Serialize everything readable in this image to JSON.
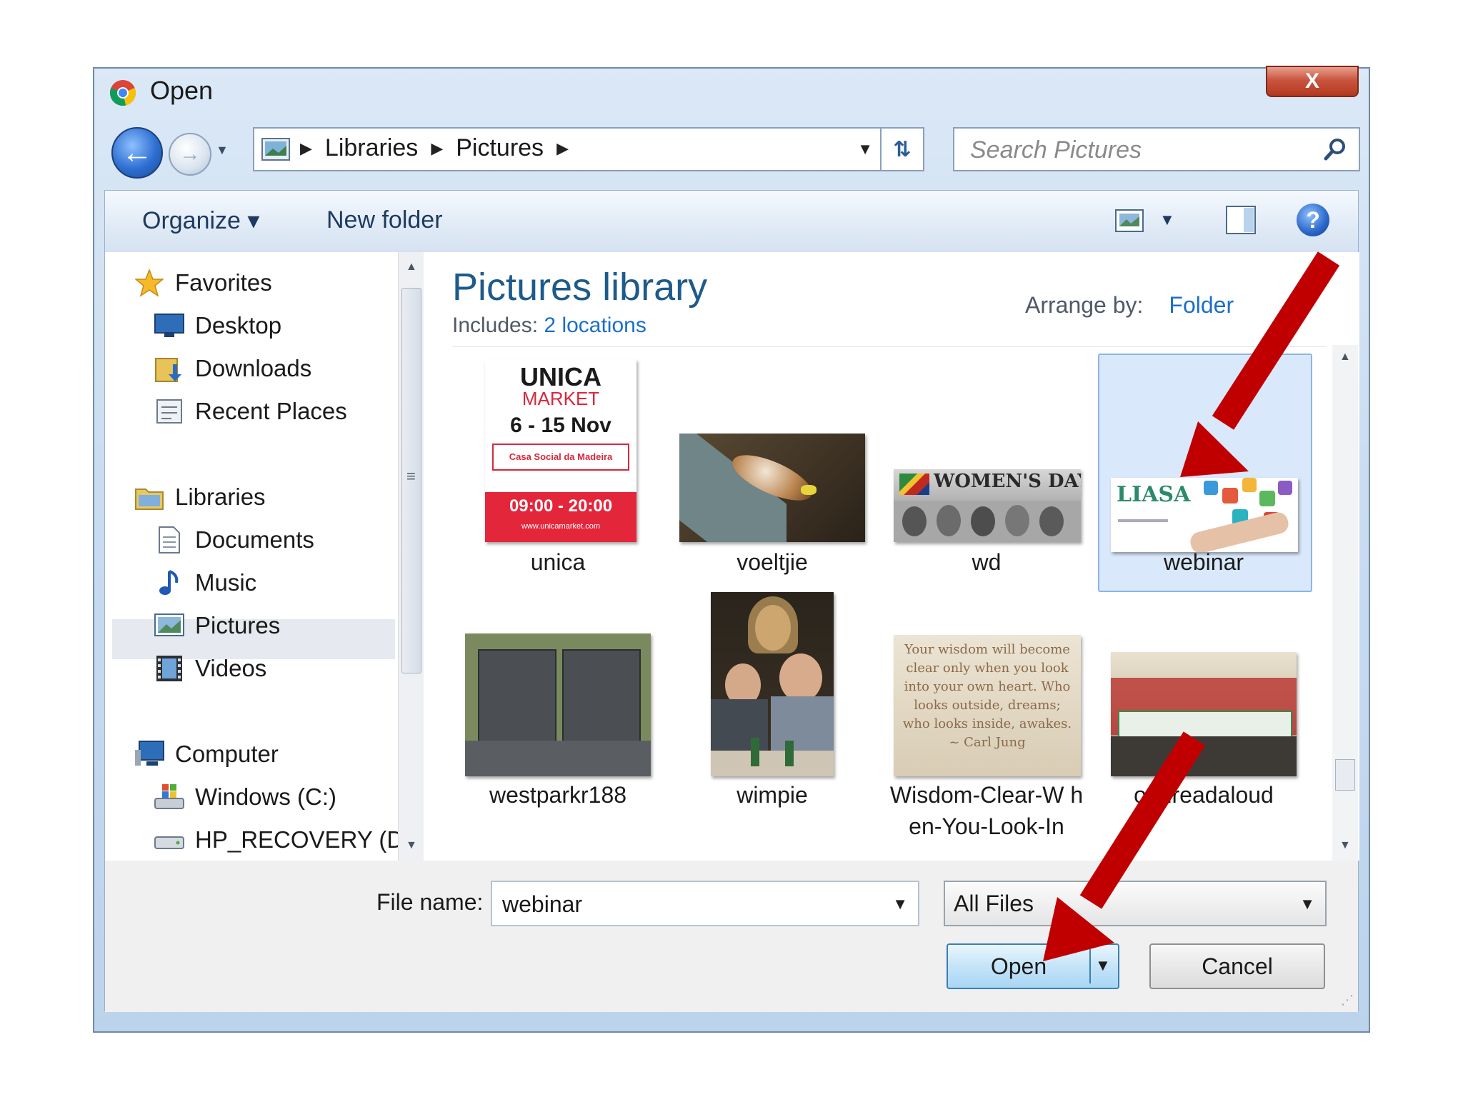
{
  "window": {
    "title": "Open",
    "close_label": "X"
  },
  "address": {
    "crumbs": [
      "Libraries",
      "Pictures"
    ],
    "search_placeholder": "Search Pictures"
  },
  "toolbar": {
    "organize": "Organize ▾",
    "new_folder": "New folder",
    "help": "?"
  },
  "nav": {
    "favorites": "Favorites",
    "desktop": "Desktop",
    "downloads": "Downloads",
    "recent": "Recent Places",
    "libraries": "Libraries",
    "documents": "Documents",
    "music": "Music",
    "pictures": "Pictures",
    "videos": "Videos",
    "computer": "Computer",
    "windows": "Windows (C:)",
    "recovery": "HP_RECOVERY (D"
  },
  "library": {
    "title": "Pictures library",
    "includes_label": "Includes:",
    "includes_link": "2 locations",
    "arrange_label": "Arrange by:",
    "arrange_value": "Folder"
  },
  "files": [
    {
      "name": "unica"
    },
    {
      "name": "voeltjie"
    },
    {
      "name": "wd"
    },
    {
      "name": "webinar",
      "selected": true
    },
    {
      "name": "westparkr188"
    },
    {
      "name": "wimpie"
    },
    {
      "name": "Wisdom-Clear-W hen-You-Look-In"
    },
    {
      "name": "orldreadaloud"
    }
  ],
  "thumb_text": {
    "unica_1": "UNICA",
    "unica_2": "MARKET",
    "unica_3": "6 - 15 Nov",
    "unica_4": "Casa Social da Madeira",
    "unica_5": "09:00 - 20:00",
    "unica_6": "www.unicamarket.com",
    "wd": "WOMEN'S DAY",
    "liasa": "LIASA",
    "wisdom": "Your wisdom will become clear only when you look into your own heart. Who looks outside, dreams; who looks inside, awakes. ~ Carl Jung"
  },
  "footer": {
    "filename_label": "File name:",
    "filename_value": "webinar",
    "filetype_value": "All Files",
    "open_label": "Open",
    "cancel_label": "Cancel"
  },
  "colors": {
    "arrow": "#c00000",
    "link": "#1b6fc9",
    "library_title": "#1e5a8a"
  }
}
